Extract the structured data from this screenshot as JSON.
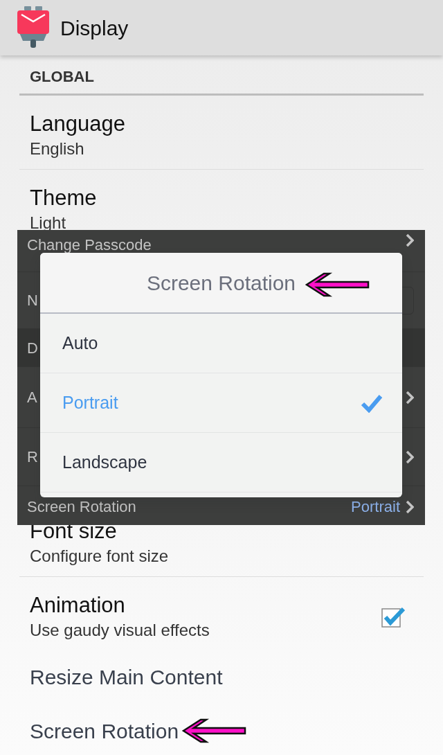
{
  "app_bar": {
    "title": "Display"
  },
  "section": {
    "header": "GLOBAL"
  },
  "settings": [
    {
      "kind": "text",
      "title": "Language",
      "summary": "English"
    },
    {
      "kind": "text",
      "title": "Theme",
      "summary": "Light"
    },
    {
      "kind": "text",
      "title": "Font size",
      "summary": "Configure font size"
    },
    {
      "kind": "checkbox",
      "title": "Animation",
      "summary": "Use gaudy visual effects",
      "checked": true
    }
  ],
  "extra_items": [
    "Resize Main Content",
    "Screen Rotation"
  ],
  "overlay": {
    "rows": [
      {
        "kind": "link",
        "label": "Change Passcode"
      },
      {
        "kind": "field",
        "label": "N"
      },
      {
        "kind": "header",
        "label": "D"
      },
      {
        "kind": "link",
        "label": "A"
      },
      {
        "kind": "link",
        "label": "R"
      },
      {
        "kind": "link",
        "label": "Screen Rotation",
        "value": "Portrait"
      }
    ],
    "dialog": {
      "title": "Screen Rotation",
      "options": [
        {
          "label": "Auto",
          "selected": false
        },
        {
          "label": "Portrait",
          "selected": true
        },
        {
          "label": "Landscape",
          "selected": false
        }
      ]
    }
  }
}
